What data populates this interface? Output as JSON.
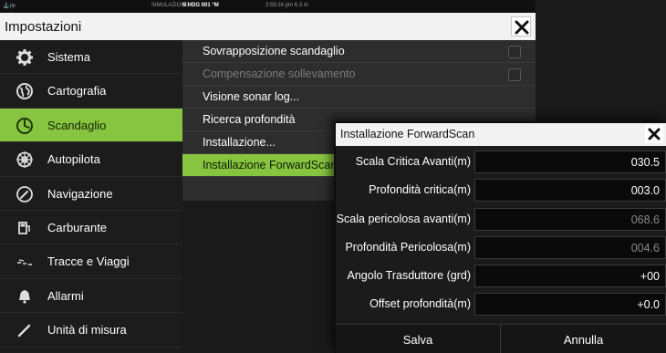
{
  "status_bar": {
    "left_icons": "⚓|⊕",
    "simulation": "SIMULAZIONE...",
    "heading": "S HDG 001 °M",
    "time": "3:59:24 pm  6.3 m"
  },
  "window": {
    "title": "Impostazioni",
    "close_icon": "close-icon"
  },
  "sidebar": {
    "items": [
      {
        "label": "Sistema",
        "icon": "gear-icon",
        "active": false
      },
      {
        "label": "Cartografia",
        "icon": "globe-icon",
        "active": false
      },
      {
        "label": "Scandaglio",
        "icon": "sonar-icon",
        "active": true
      },
      {
        "label": "Autopilota",
        "icon": "helm-icon",
        "active": false
      },
      {
        "label": "Navigazione",
        "icon": "compass-icon",
        "active": false
      },
      {
        "label": "Carburante",
        "icon": "fuel-pump-icon",
        "active": false
      },
      {
        "label": "Tracce e Viaggi",
        "icon": "trail-icon",
        "active": false
      },
      {
        "label": "Allarmi",
        "icon": "bell-icon",
        "active": false
      },
      {
        "label": "Unità di misura",
        "icon": "ruler-icon",
        "active": false
      }
    ]
  },
  "submenu": {
    "items": [
      {
        "label": "Sovrapposizione scandaglio",
        "checkbox": true,
        "checked": false,
        "disabled": false
      },
      {
        "label": "Compensazione sollevamento",
        "checkbox": true,
        "checked": false,
        "disabled": true
      },
      {
        "label": "Visione sonar log...",
        "checkbox": false,
        "disabled": false
      },
      {
        "label": "Ricerca profondità",
        "checkbox": false,
        "disabled": false
      },
      {
        "label": "Installazione...",
        "checkbox": false,
        "disabled": false
      },
      {
        "label": "Installazione ForwardScan...",
        "checkbox": false,
        "disabled": false,
        "active": true
      }
    ]
  },
  "dialog": {
    "title": "Installazione ForwardScan",
    "fields": [
      {
        "label": "Scala Critica Avanti(m)",
        "value": "030.5",
        "dim": false
      },
      {
        "label": "Profondità critica(m)",
        "value": "003.0",
        "dim": false
      },
      {
        "label": "Scala pericolosa avanti(m)",
        "value": "068.6",
        "dim": true
      },
      {
        "label": "Profondità Pericolosa(m)",
        "value": "004.6",
        "dim": true
      },
      {
        "label": "Angolo Trasduttore (grd)",
        "value": "+00",
        "dim": false
      },
      {
        "label": "Offset profondità(m)",
        "value": "+0.0",
        "dim": false
      }
    ],
    "save_label": "Salva",
    "cancel_label": "Annulla"
  },
  "colors": {
    "accent": "#87c540",
    "title_bar": "#f2f2f2",
    "panel": "#2d2d2d",
    "sidebar": "#1c1c1c"
  }
}
